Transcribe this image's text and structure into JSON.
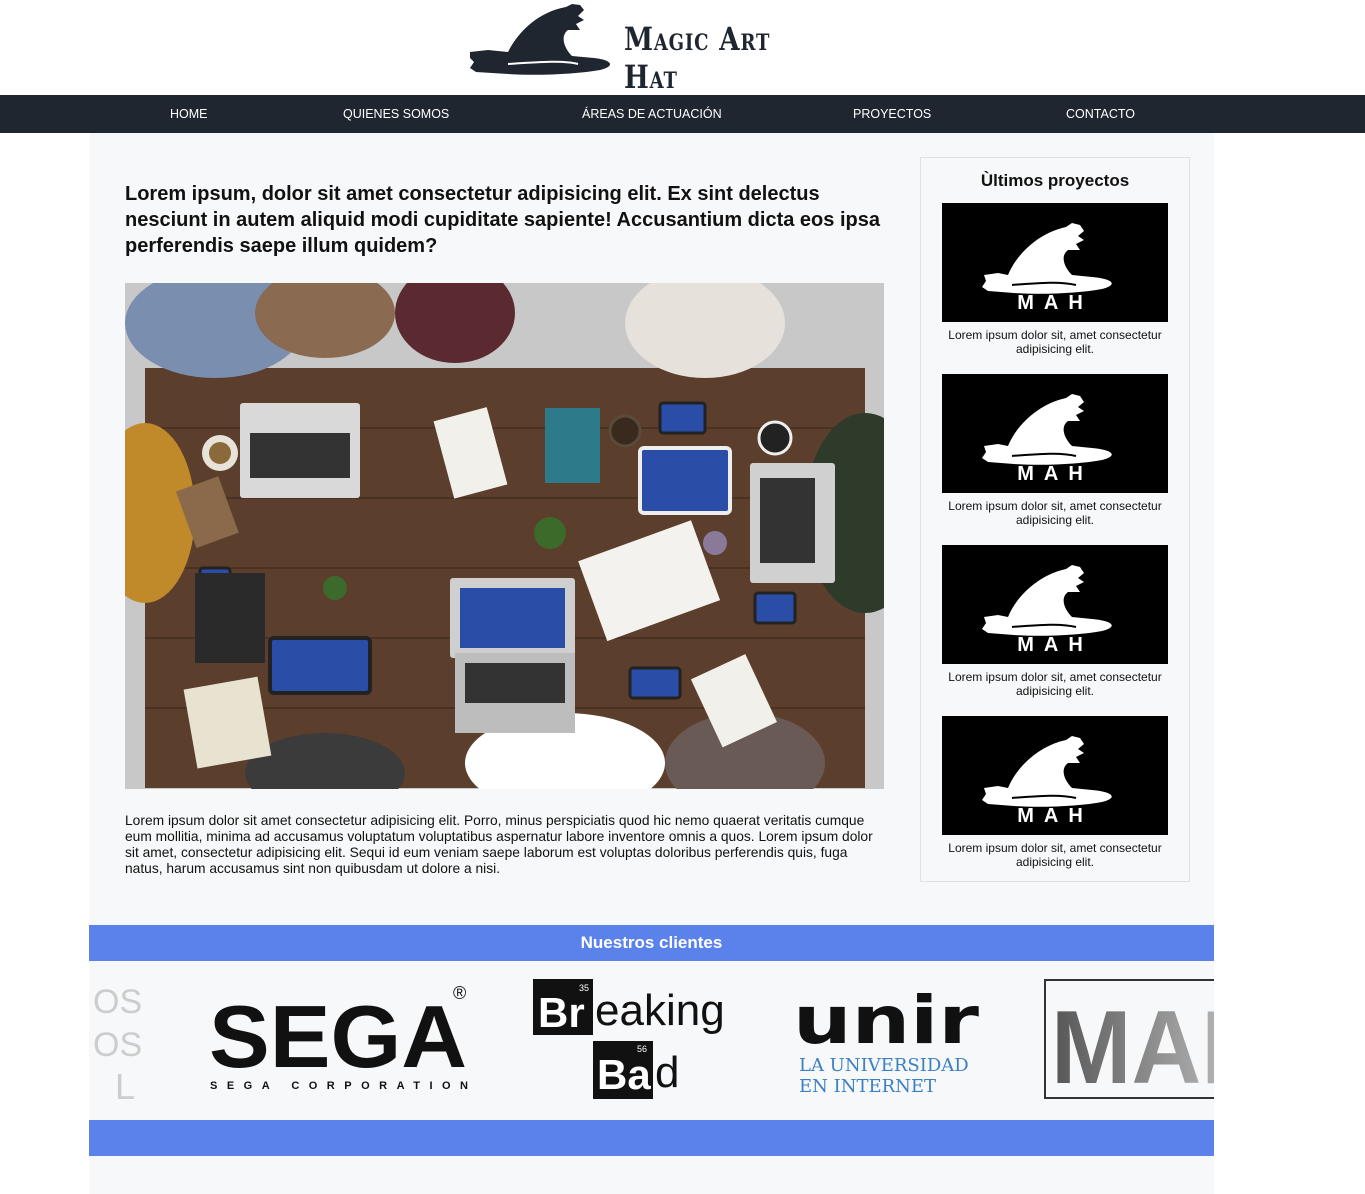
{
  "header": {
    "brand": "Magic Art Hat"
  },
  "nav": {
    "items": [
      {
        "label": "HOME"
      },
      {
        "label": "QUIENES SOMOS"
      },
      {
        "label": "ÁREAS DE ACTUACIÓN"
      },
      {
        "label": "PROYECTOS"
      },
      {
        "label": "CONTACTO"
      }
    ]
  },
  "article": {
    "title": "Lorem ipsum, dolor sit amet consectetur adipisicing elit. Ex sint delectus nesciunt in autem aliquid modi cupiditate sapiente! Accusantium dicta eos ipsa perferendis saepe illum quidem?",
    "image_alt": "office-meeting-photo",
    "body": "Lorem ipsum dolor sit amet consectetur adipisicing elit. Porro, minus perspiciatis quod hic nemo quaerat veritatis cumque eum mollitia, minima ad accusamus voluptatum voluptatibus aspernatur labore inventore omnis a quos. Lorem ipsum dolor sit amet, consectetur adipisicing elit. Sequi id eum veniam saepe laborum est voluptas doloribus perferendis quis, fuga natus, harum accusamus sint non quibusdam ut dolore a nisi."
  },
  "sidebar": {
    "title": "Ùltimos proyectos",
    "projects": [
      {
        "logo_text": "MAH",
        "caption": "Lorem ipsum dolor sit, amet consectetur adipisicing elit."
      },
      {
        "logo_text": "MAH",
        "caption": "Lorem ipsum dolor sit, amet consectetur adipisicing elit."
      },
      {
        "logo_text": "MAH",
        "caption": "Lorem ipsum dolor sit, amet consectetur adipisicing elit."
      },
      {
        "logo_text": "MAH",
        "caption": "Lorem ipsum dolor sit, amet consectetur adipisicing elit."
      }
    ]
  },
  "clients": {
    "title": "Nuestros clientes",
    "logos": {
      "partial_left": [
        "OS",
        "OS",
        "L"
      ],
      "sega": {
        "name": "SEGA",
        "registered": "®",
        "sub": "SEGA CORPORATION"
      },
      "breaking_bad": {
        "br": "Br",
        "br_num": "35",
        "eaking": "eaking",
        "ba": "Ba",
        "ba_num": "56",
        "d": "d"
      },
      "unir": {
        "name": "unir",
        "line1": "LA UNIVERSIDAD",
        "line2": "EN INTERNET"
      },
      "marvel": {
        "name": "MAR"
      }
    }
  },
  "colors": {
    "nav_bg": "#1f2630",
    "accent_blue": "#5a82ea",
    "page_bg": "#f7f8f9"
  }
}
